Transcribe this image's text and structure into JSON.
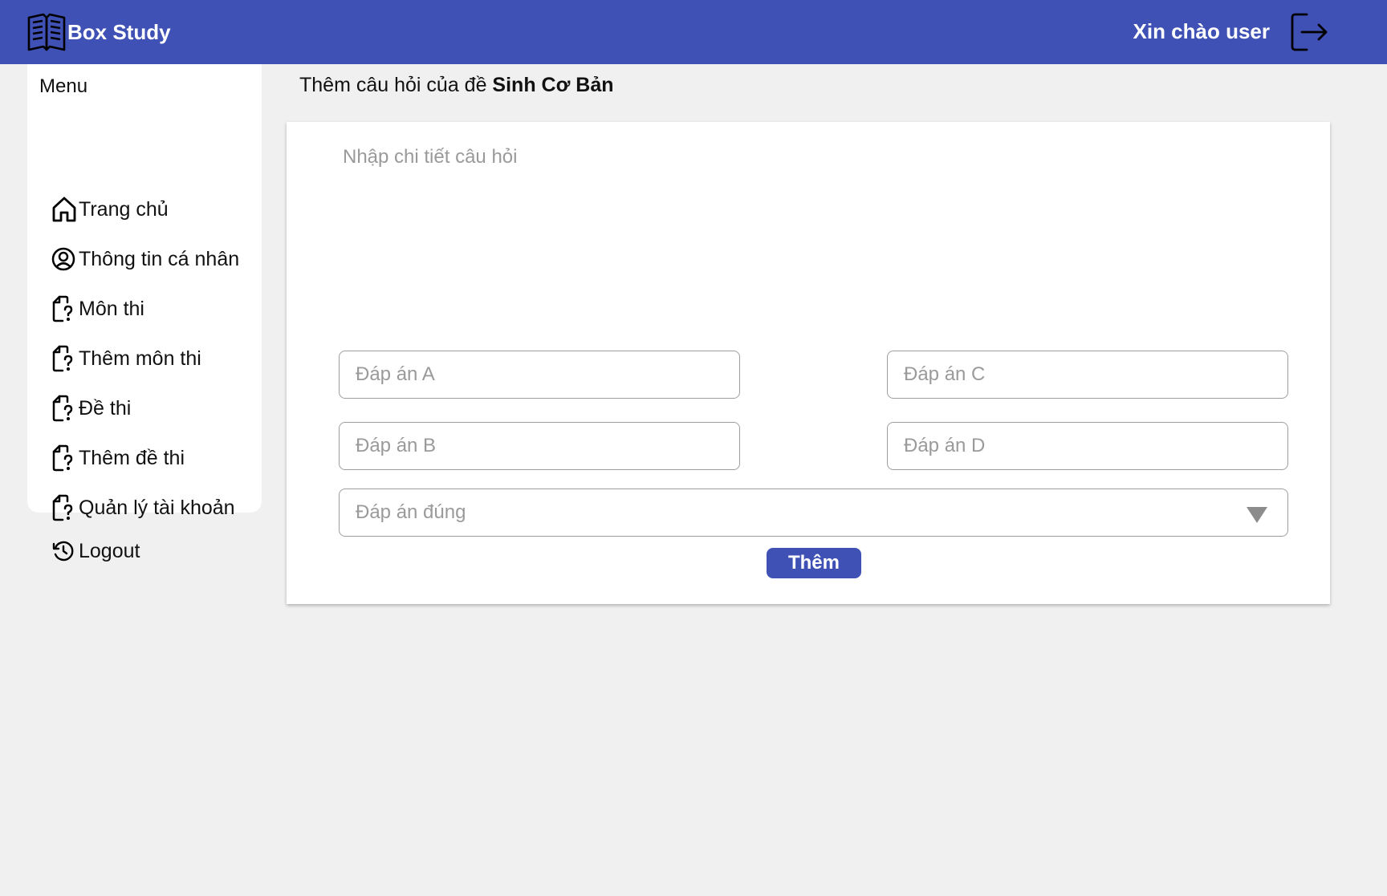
{
  "header": {
    "brand_name": "Box Study",
    "greeting": "Xin chào user",
    "brand_icon": "book-icon",
    "logout_icon": "logout-arrow-icon",
    "background_color": "#3f51b5"
  },
  "sidebar": {
    "title": "Menu",
    "items": [
      {
        "label": "Trang chủ",
        "icon": "home-icon"
      },
      {
        "label": "Thông tin cá nhân",
        "icon": "user-circle-icon"
      },
      {
        "label": "Môn thi",
        "icon": "document-question-icon"
      },
      {
        "label": "Thêm môn thi",
        "icon": "document-question-icon"
      },
      {
        "label": "Đề thi",
        "icon": "document-question-icon"
      },
      {
        "label": "Thêm đề thi",
        "icon": "document-question-icon"
      },
      {
        "label": "Quản lý tài khoản",
        "icon": "document-question-icon"
      },
      {
        "label": "Logout",
        "icon": "history-icon"
      }
    ]
  },
  "main": {
    "heading_prefix": "Thêm câu hỏi của đề ",
    "heading_exam": "Sinh Cơ Bản",
    "question_placeholder": "Nhập chi tiết câu hỏi",
    "question_value": "",
    "answers": {
      "a_placeholder": "Đáp án A",
      "b_placeholder": "Đáp án B",
      "c_placeholder": "Đáp án C",
      "d_placeholder": "Đáp án D"
    },
    "correct_answer_placeholder": "Đáp án đúng",
    "submit_label": "Thêm",
    "accent_color": "#3f51b5"
  }
}
